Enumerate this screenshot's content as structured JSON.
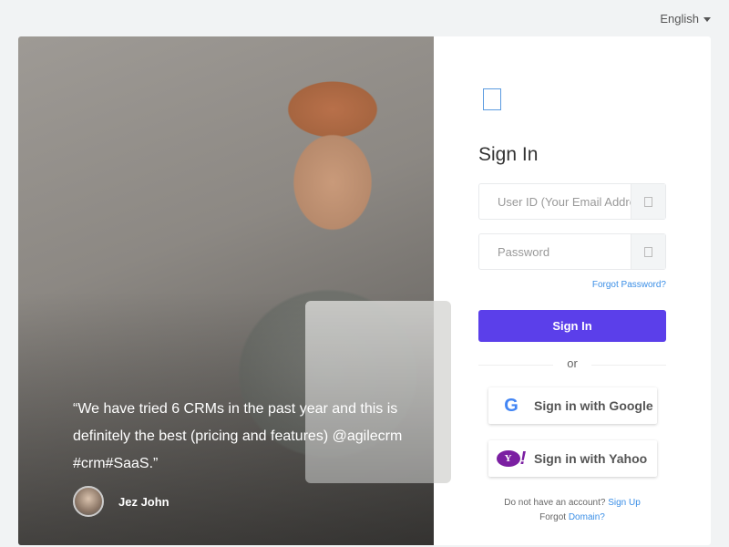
{
  "language": "English",
  "testimonial": {
    "quote": "“We have tried 6 CRMs in the past year and this is definitely the best (pricing and features) @agilecrm #crm#SaaS.”",
    "author": "Jez John"
  },
  "signin": {
    "title": "Sign In",
    "user_placeholder": "User ID (Your Email Address)",
    "password_placeholder": "Password",
    "forgot_password": "Forgot Password?",
    "button": "Sign In",
    "or": "or",
    "google": "Sign in with Google",
    "google_icon": "G",
    "yahoo": "Sign in with Yahoo",
    "yahoo_icon": "Y",
    "no_account": "Do not have an account?",
    "sign_up": "Sign Up",
    "forgot": "Forgot",
    "domain": "Domain?"
  },
  "colors": {
    "primary": "#5b3fea",
    "link": "#3a8ee6",
    "yahoo": "#7b1fa2"
  }
}
